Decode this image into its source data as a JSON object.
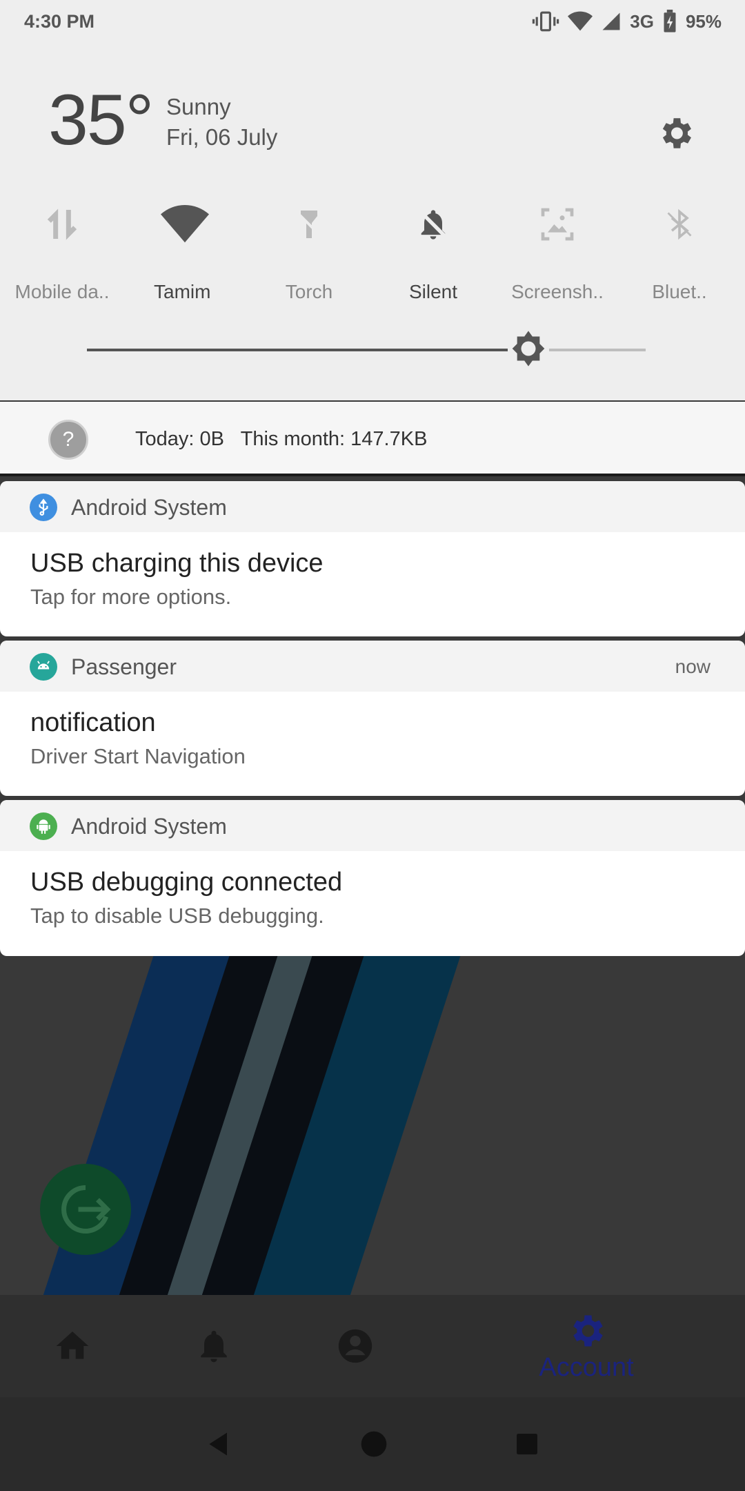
{
  "status_bar": {
    "time": "4:30 PM",
    "network": "3G",
    "battery": "95%"
  },
  "weather": {
    "temp": "35°",
    "condition": "Sunny",
    "date": "Fri, 06 July"
  },
  "quick_settings": [
    {
      "label": "Mobile da..",
      "icon": "mobile-data-icon",
      "active": false
    },
    {
      "label": "Tamim",
      "icon": "wifi-icon",
      "active": true
    },
    {
      "label": "Torch",
      "icon": "torch-icon",
      "active": false
    },
    {
      "label": "Silent",
      "icon": "silent-icon",
      "active": true
    },
    {
      "label": "Screensh..",
      "icon": "screenshot-icon",
      "active": false
    },
    {
      "label": "Bluet..",
      "icon": "bluetooth-icon",
      "active": false
    }
  ],
  "brightness": {
    "level": 0.79
  },
  "data_usage": {
    "text": "Today: 0B   This month: 147.7KB"
  },
  "notifications": [
    {
      "app": "Android System",
      "time": "",
      "title": "USB charging this device",
      "body": "Tap for more options.",
      "icon": "usb-icon",
      "icon_color": "#3f8fe0"
    },
    {
      "app": "Passenger",
      "time": "now",
      "title": "notification",
      "body": "Driver Start Navigation",
      "icon": "android-icon",
      "icon_color": "#26a69a"
    },
    {
      "app": "Android System",
      "time": "",
      "title": "USB debugging connected",
      "body": "Tap to disable USB debugging.",
      "icon": "android-icon",
      "icon_color": "#4caf50"
    }
  ],
  "bottom_nav": {
    "account_label": "Account"
  },
  "colors": {
    "accent": "#1a237e",
    "shade": "#eeeeee"
  }
}
